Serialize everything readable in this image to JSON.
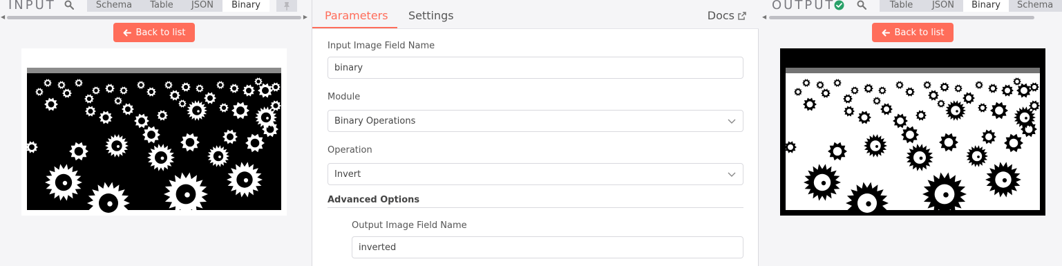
{
  "input_pane": {
    "title": "INPUT",
    "tabs": [
      {
        "label": "Schema",
        "active": false
      },
      {
        "label": "Table",
        "active": false
      },
      {
        "label": "JSON",
        "active": false
      },
      {
        "label": "Binary",
        "active": true
      }
    ],
    "back_label": "Back to list",
    "image": {
      "kind": "sunflowers-thresholded",
      "tone": "white flowers on black background"
    }
  },
  "center_panel": {
    "tabs": [
      {
        "label": "Parameters",
        "active": true
      },
      {
        "label": "Settings",
        "active": false
      }
    ],
    "docs_label": "Docs",
    "fields": {
      "input_image_field": {
        "label": "Input Image Field Name",
        "value": "binary"
      },
      "module": {
        "label": "Module",
        "value": "Binary Operations"
      },
      "operation": {
        "label": "Operation",
        "value": "Invert"
      }
    },
    "advanced": {
      "title": "Advanced Options",
      "output_image_field": {
        "label": "Output Image Field Name",
        "value": "inverted"
      }
    }
  },
  "output_pane": {
    "title": "OUTPUT",
    "status": "success",
    "tabs": [
      {
        "label": "Table",
        "active": false
      },
      {
        "label": "JSON",
        "active": false
      },
      {
        "label": "Binary",
        "active": true
      },
      {
        "label": "Schema",
        "active": false
      }
    ],
    "back_label": "Back to list",
    "image": {
      "kind": "sunflowers-inverted",
      "tone": "black flowers on white background"
    }
  },
  "colors": {
    "accent": "#ff6d5a",
    "success": "#29a168",
    "tab_bg": "#dcdde3",
    "pane_bg": "#f5f5f7"
  },
  "icons": [
    "search-icon",
    "pin-icon",
    "arrow-left-icon",
    "external-link-icon",
    "chevron-down-icon",
    "check-circle-icon"
  ]
}
